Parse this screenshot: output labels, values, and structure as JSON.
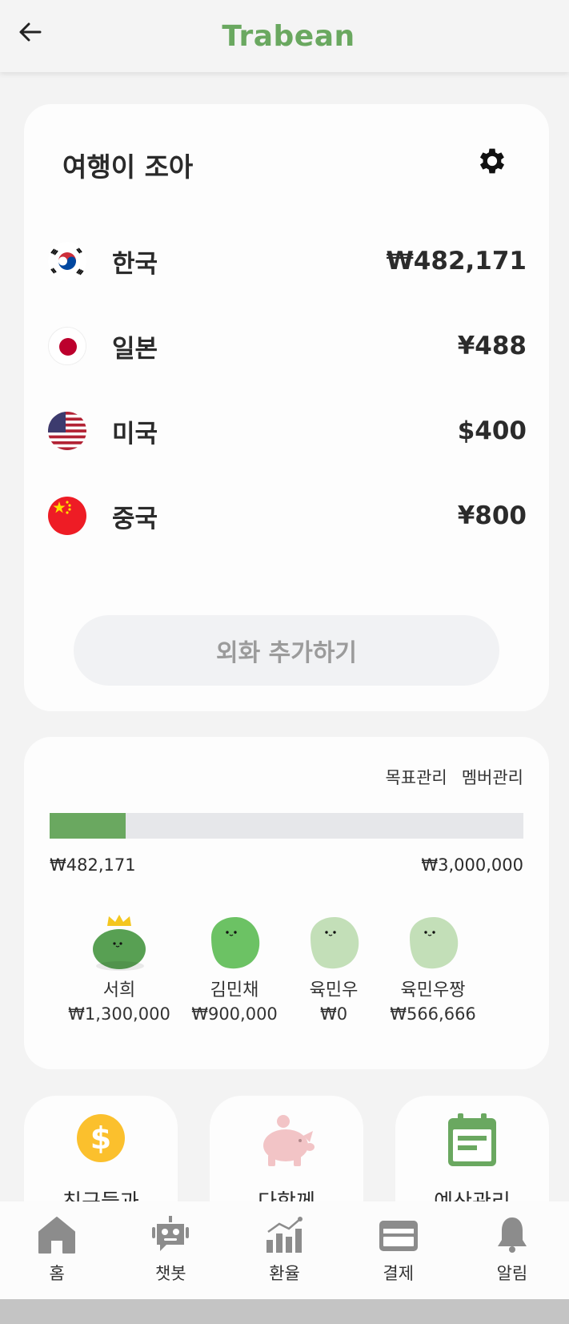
{
  "app": {
    "brand": "Trabean"
  },
  "wallet": {
    "title": "여행이 조아",
    "currencies": [
      {
        "name": "한국",
        "amount": "₩482,171",
        "flag": "korea-flag"
      },
      {
        "name": "일본",
        "amount": "¥488",
        "flag": "japan-flag"
      },
      {
        "name": "미국",
        "amount": "$400",
        "flag": "usa-flag"
      },
      {
        "name": "중국",
        "amount": "¥800",
        "flag": "china-flag"
      }
    ],
    "add_label": "외화 추가하기"
  },
  "goal": {
    "links": [
      "목표관리",
      "멤버관리"
    ],
    "current": "₩482,171",
    "target": "₩3,000,000",
    "progress_fraction": 0.16,
    "members": [
      {
        "name": "서희",
        "amount": "₩1,300,000",
        "color": "#58a053",
        "crown": true
      },
      {
        "name": "김민채",
        "amount": "₩900,000",
        "color": "#6cc264",
        "crown": false
      },
      {
        "name": "육민우",
        "amount": "₩0",
        "color": "#c3dfb8",
        "crown": false
      },
      {
        "name": "육민우짱",
        "amount": "₩566,666",
        "color": "#c3dfb8",
        "crown": false
      }
    ]
  },
  "quick": [
    {
      "label": "친구들과",
      "icon": "dollar-coin-icon",
      "color": "#fbc02d"
    },
    {
      "label": "다함께",
      "icon": "piggy-bank-icon",
      "color": "#f2c4c6"
    },
    {
      "label": "예산관리",
      "icon": "calendar-icon",
      "color": "#6aa860"
    }
  ],
  "nav": [
    {
      "label": "홈",
      "icon": "home-icon"
    },
    {
      "label": "챗봇",
      "icon": "robot-icon"
    },
    {
      "label": "환율",
      "icon": "chart-icon"
    },
    {
      "label": "결제",
      "icon": "card-icon"
    },
    {
      "label": "알림",
      "icon": "bell-icon"
    }
  ],
  "colors": {
    "brand": "#6aa860",
    "icon_gray": "#8c8c8c"
  }
}
